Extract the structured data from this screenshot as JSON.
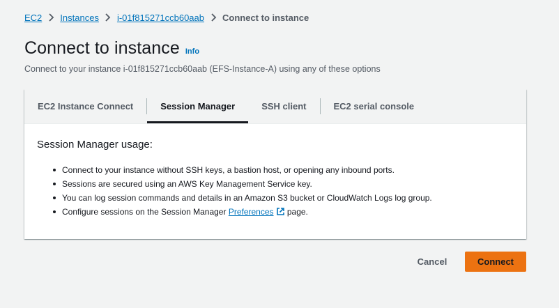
{
  "breadcrumb": {
    "items": [
      "EC2",
      "Instances",
      "i-01f815271ccb60aab"
    ],
    "current": "Connect to instance"
  },
  "page": {
    "title": "Connect to instance",
    "info_label": "Info",
    "subtitle": "Connect to your instance i-01f815271ccb60aab (EFS-Instance-A) using any of these options"
  },
  "tabs": [
    {
      "label": "EC2 Instance Connect"
    },
    {
      "label": "Session Manager"
    },
    {
      "label": "SSH client"
    },
    {
      "label": "EC2 serial console"
    }
  ],
  "session_manager": {
    "heading": "Session Manager usage:",
    "bullets": [
      "Connect to your instance without SSH keys, a bastion host, or opening any inbound ports.",
      "Sessions are secured using an AWS Key Management Service key.",
      "You can log session commands and details in an Amazon S3 bucket or CloudWatch Logs log group."
    ],
    "last_bullet_prefix": "Configure sessions on the Session Manager ",
    "preferences_link": "Preferences",
    "last_bullet_suffix": " page."
  },
  "actions": {
    "cancel_label": "Cancel",
    "connect_label": "Connect"
  },
  "colors": {
    "link": "#0073bb",
    "primary_button": "#ec7211",
    "background": "#f2f3f3"
  }
}
